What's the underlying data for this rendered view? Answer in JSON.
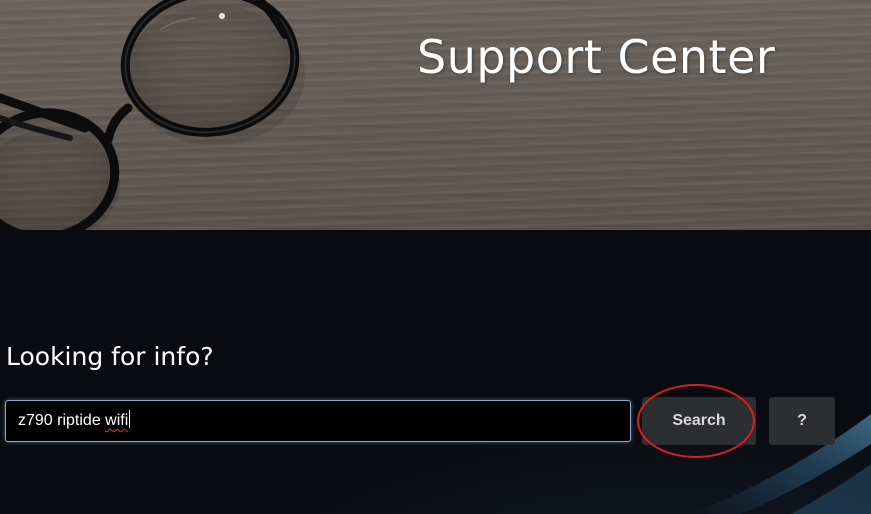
{
  "hero": {
    "title": "Support Center",
    "image": "glasses-on-wood-desk"
  },
  "search": {
    "heading": "Looking for info?",
    "input": {
      "value_prefix": "z790 riptide ",
      "value_flagged_word": "wifi",
      "full_value": "z790 riptide wifi"
    },
    "search_button_label": "Search",
    "help_button_label": "?"
  },
  "colors": {
    "highlight_ring": "#d81f26",
    "button_bg": "#2d2e31",
    "field_border": "#8fa7c4"
  }
}
